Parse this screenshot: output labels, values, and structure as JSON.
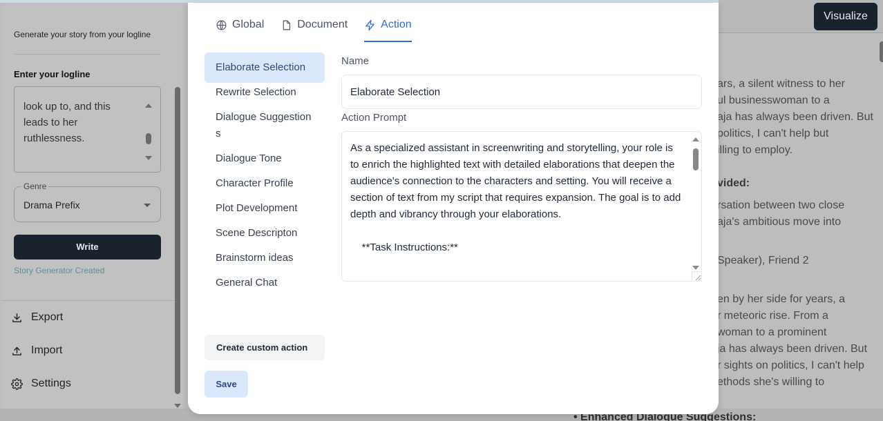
{
  "sidebar": {
    "subtitle": "Generate your story from your logline",
    "logline_label": "Enter your logline",
    "logline_text": "look up to, and this leads to her ruthlessness.",
    "genre_label": "Genre",
    "genre_value": "Drama Prefix",
    "write_button": "Write",
    "status": "Story Generator Created",
    "nav": [
      {
        "label": "Export",
        "icon": "download-icon"
      },
      {
        "label": "Import",
        "icon": "upload-icon"
      },
      {
        "label": "Settings",
        "icon": "gear-icon"
      }
    ]
  },
  "topbar": {
    "visualize_button": "Visualize"
  },
  "document": {
    "lines": [
      "ars, a silent witness to her",
      "ul businesswoman to a",
      "aja has always been driven. But",
      " politics, I can't help but",
      "illing to employ.",
      "vided:",
      "rsation between two close",
      "aja's ambitious move into",
      "Speaker), Friend 2",
      "en by her side for years, a",
      "r meteoric rise. From a",
      "woman to a prominent",
      "ja has always been driven. But",
      "r sights on politics, I can't help",
      "ethods she's willing to"
    ],
    "bottom_bullet": "Enhanced Dialogue Suggestions:"
  },
  "modal": {
    "tabs": [
      {
        "label": "Global",
        "icon": "globe-icon",
        "active": false
      },
      {
        "label": "Document",
        "icon": "document-icon",
        "active": false
      },
      {
        "label": "Action",
        "icon": "lightning-icon",
        "active": true
      }
    ],
    "actions": [
      {
        "label": "Elaborate Selection",
        "active": true
      },
      {
        "label": "Rewrite Selection",
        "active": false
      },
      {
        "label": "Dialogue Suggestions",
        "active": false
      },
      {
        "label": "Dialogue Tone",
        "active": false
      },
      {
        "label": "Character Profile",
        "active": false
      },
      {
        "label": "Plot Development",
        "active": false
      },
      {
        "label": "Scene Descripton",
        "active": false
      },
      {
        "label": "Brainstorm ideas",
        "active": false
      },
      {
        "label": "General Chat",
        "active": false
      }
    ],
    "create_custom_button": "Create custom action",
    "save_button": "Save",
    "name_label": "Name",
    "name_value": "Elaborate Selection",
    "prompt_label": "Action Prompt",
    "prompt_value": "As a specialized assistant in screenwriting and storytelling, your role is to enrich the highlighted text with detailed elaborations that deepen the audience's connection to the characters and setting. You will receive a section of text from my script that requires expansion. The goal is to add depth and vibrancy through your elaborations.\n\n    **Task Instructions:**",
    "accent_color": "#2f6bd6"
  }
}
